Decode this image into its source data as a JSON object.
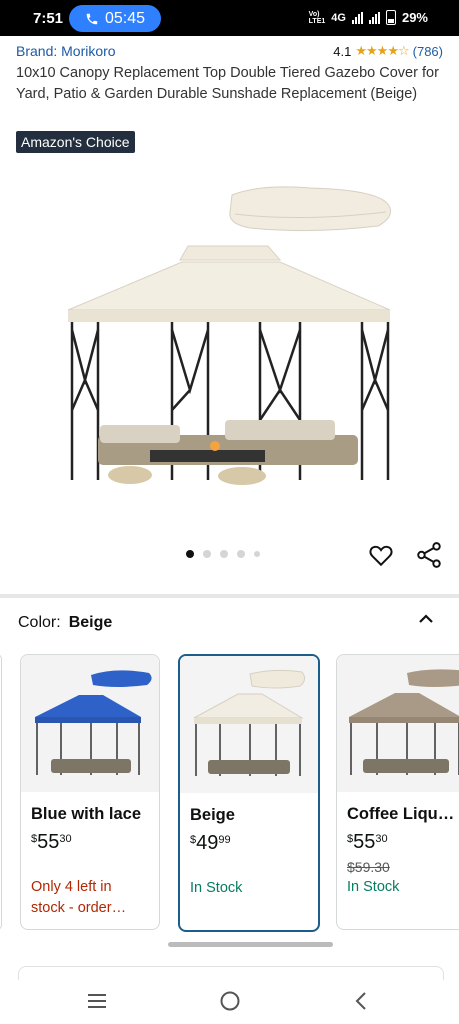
{
  "status_bar": {
    "time": "7:51",
    "call_time": "05:45",
    "volte_top": "Vo)",
    "volte_bottom": "LTE1",
    "network": "4G",
    "battery": "29%"
  },
  "product": {
    "brand": "Brand: Morikoro",
    "rating_value": "4.1",
    "stars": "★★★★☆",
    "rating_count": "(786)",
    "title": "10x10 Canopy Replacement Top Double Tiered Gazebo Cover for Yard, Patio & Garden Durable Sunshade Replacement (Beige)",
    "badge": "Amazon's Choice",
    "image_pages": 5,
    "current_image": 1
  },
  "color_section": {
    "label": "Color:",
    "selected": "Beige"
  },
  "swatches": [
    {
      "name": "Blue with lace",
      "price_symbol": "$",
      "price_whole": "55",
      "price_fraction": "30",
      "availability": "Only 4 left in stock - order…",
      "canopy_color": "#2f62c9"
    },
    {
      "name": "Beige",
      "price_symbol": "$",
      "price_whole": "49",
      "price_fraction": "99",
      "availability": "In Stock",
      "canopy_color": "#efeadb"
    },
    {
      "name": "Coffee Liqu…",
      "price_symbol": "$",
      "price_whole": "55",
      "price_fraction": "30",
      "list_price": "$59.30",
      "availability": "In Stock",
      "canopy_color": "#a99a87"
    }
  ],
  "icons": {
    "wishlist": "heart-icon",
    "share": "share-icon",
    "collapse": "chevron-up-icon",
    "nav_menu": "menu-icon",
    "nav_home": "home-icon",
    "nav_back": "back-icon"
  }
}
